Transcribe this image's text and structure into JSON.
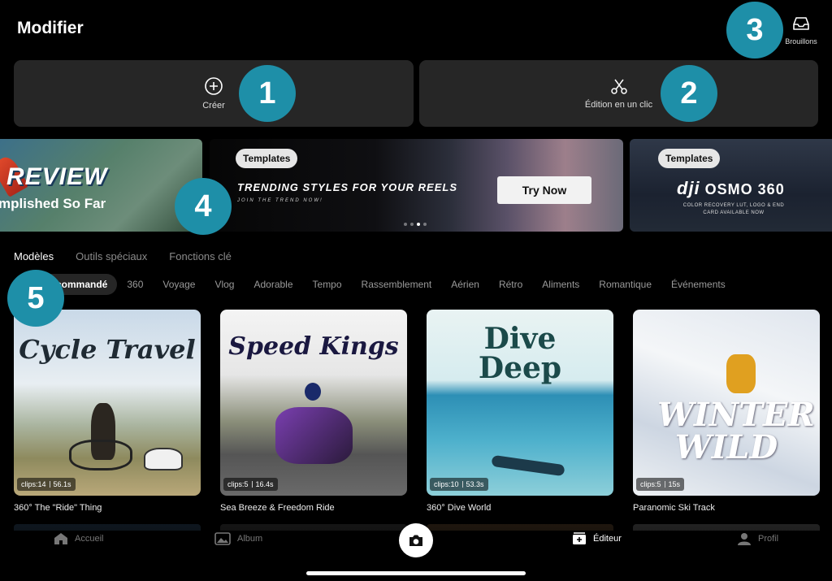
{
  "header": {
    "title": "Modifier",
    "drafts_label": "Brouillons",
    "drafts_icon": "inbox-icon"
  },
  "actions": [
    {
      "label": "Créer",
      "icon": "plus-circle-icon"
    },
    {
      "label": "Édition en un clic",
      "icon": "scissors-icon"
    }
  ],
  "annotations": [
    "1",
    "2",
    "3",
    "4",
    "5"
  ],
  "banners": {
    "left": {
      "line1": "REVIEW",
      "line2": "mplished So Far"
    },
    "middle": {
      "tag": "Templates",
      "headline": "TRENDING STYLES FOR YOUR REELS",
      "sub": "JOIN THE TREND NOW!",
      "button": "Try Now"
    },
    "right": {
      "tag": "Templates",
      "brand_logo": "dji",
      "brand": "OSMO 360",
      "line1": "COLOR RECOVERY LUT, LOGO & END",
      "line2": "CARD AVAILABLE NOW"
    }
  },
  "section_tabs": [
    "Modèles",
    "Outils spéciaux",
    "Fonctions clé"
  ],
  "section_active": 0,
  "chips": [
    "Recommandé",
    "360",
    "Voyage",
    "Vlog",
    "Adorable",
    "Tempo",
    "Rassemblement",
    "Aérien",
    "Rétro",
    "Aliments",
    "Romantique",
    "Événements"
  ],
  "chip_active_visible": "commandé",
  "templates": [
    {
      "art_title": "Cycle Travel",
      "clips": "clips:14",
      "duration": "56.1s",
      "name": "360° The \"Ride\" Thing"
    },
    {
      "art_title": "Speed Kings",
      "clips": "clips:5",
      "duration": "16.4s",
      "name": "Sea Breeze & Freedom Ride"
    },
    {
      "art_title": "Dive Deep",
      "clips": "clips:10",
      "duration": "53.3s",
      "name": "360° Dive World"
    },
    {
      "art_title": "WINTER WILD",
      "clips": "clips:5",
      "duration": "15s",
      "name": "Paranomic Ski Track"
    }
  ],
  "nav": [
    {
      "label": "Accueil",
      "icon": "home-icon",
      "active": false
    },
    {
      "label": "Album",
      "icon": "album-icon",
      "active": false
    },
    {
      "label": "Éditeur",
      "icon": "editor-icon",
      "active": true
    },
    {
      "label": "Profil",
      "icon": "profile-icon",
      "active": false
    }
  ],
  "colors": {
    "badge": "#1e8fa8",
    "card": "#262626",
    "background": "#000000"
  }
}
